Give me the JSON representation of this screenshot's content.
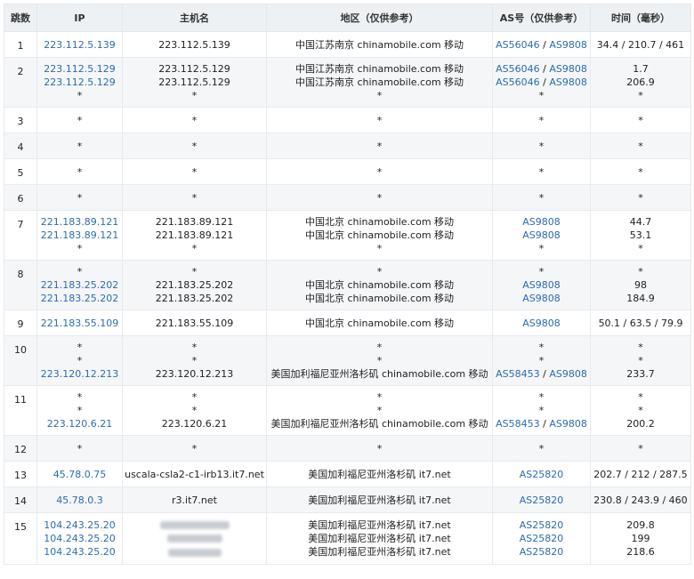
{
  "headers": {
    "hop": "跳数",
    "ip": "IP",
    "host": "主机名",
    "region": "地区（仅供参考）",
    "as": "AS号（仅供参考）",
    "time": "时间（毫秒）"
  },
  "rows": [
    {
      "hop": "1",
      "ip": [
        "223.112.5.139"
      ],
      "host": [
        "223.112.5.139"
      ],
      "region": [
        "中国江苏南京 chinamobile.com 移动"
      ],
      "as": [
        [
          "AS56046",
          "AS9808"
        ]
      ],
      "time": [
        "34.4 / 210.7 / 461"
      ]
    },
    {
      "hop": "2",
      "ip": [
        "223.112.5.129",
        "223.112.5.129",
        "*"
      ],
      "host": [
        "223.112.5.129",
        "223.112.5.129",
        "*"
      ],
      "region": [
        "中国江苏南京 chinamobile.com 移动",
        "中国江苏南京 chinamobile.com 移动",
        "*"
      ],
      "as": [
        [
          "AS56046",
          "AS9808"
        ],
        [
          "AS56046",
          "AS9808"
        ],
        "*"
      ],
      "time": [
        "1.7",
        "206.9",
        "*"
      ]
    },
    {
      "hop": "3",
      "ip": [
        "*"
      ],
      "host": [
        "*"
      ],
      "region": [
        "*"
      ],
      "as": [
        "*"
      ],
      "time": [
        "*"
      ]
    },
    {
      "hop": "4",
      "ip": [
        "*"
      ],
      "host": [
        "*"
      ],
      "region": [
        "*"
      ],
      "as": [
        "*"
      ],
      "time": [
        "*"
      ]
    },
    {
      "hop": "5",
      "ip": [
        "*"
      ],
      "host": [
        "*"
      ],
      "region": [
        "*"
      ],
      "as": [
        "*"
      ],
      "time": [
        "*"
      ]
    },
    {
      "hop": "6",
      "ip": [
        "*"
      ],
      "host": [
        "*"
      ],
      "region": [
        "*"
      ],
      "as": [
        "*"
      ],
      "time": [
        "*"
      ]
    },
    {
      "hop": "7",
      "ip": [
        "221.183.89.121",
        "221.183.89.121",
        "*"
      ],
      "host": [
        "221.183.89.121",
        "221.183.89.121",
        "*"
      ],
      "region": [
        "中国北京 chinamobile.com 移动",
        "中国北京 chinamobile.com 移动",
        "*"
      ],
      "as": [
        [
          "AS9808"
        ],
        [
          "AS9808"
        ],
        "*"
      ],
      "time": [
        "44.7",
        "53.1",
        "*"
      ]
    },
    {
      "hop": "8",
      "ip": [
        "*",
        "221.183.25.202",
        "221.183.25.202"
      ],
      "host": [
        "*",
        "221.183.25.202",
        "221.183.25.202"
      ],
      "region": [
        "*",
        "中国北京 chinamobile.com 移动",
        "中国北京 chinamobile.com 移动"
      ],
      "as": [
        "*",
        [
          "AS9808"
        ],
        [
          "AS9808"
        ]
      ],
      "time": [
        "*",
        "98",
        "184.9"
      ]
    },
    {
      "hop": "9",
      "ip": [
        "221.183.55.109"
      ],
      "host": [
        "221.183.55.109"
      ],
      "region": [
        "中国北京 chinamobile.com 移动"
      ],
      "as": [
        [
          "AS9808"
        ]
      ],
      "time": [
        "50.1 / 63.5 / 79.9"
      ]
    },
    {
      "hop": "10",
      "ip": [
        "*",
        "*",
        "223.120.12.213"
      ],
      "host": [
        "*",
        "*",
        "223.120.12.213"
      ],
      "region": [
        "*",
        "*",
        "美国加利福尼亚州洛杉矶 chinamobile.com 移动"
      ],
      "as": [
        "*",
        "*",
        [
          "AS58453",
          "AS9808"
        ]
      ],
      "time": [
        "*",
        "*",
        "233.7"
      ]
    },
    {
      "hop": "11",
      "ip": [
        "*",
        "*",
        "223.120.6.21"
      ],
      "host": [
        "*",
        "*",
        "223.120.6.21"
      ],
      "region": [
        "*",
        "*",
        "美国加利福尼亚州洛杉矶 chinamobile.com 移动"
      ],
      "as": [
        "*",
        "*",
        [
          "AS58453",
          "AS9808"
        ]
      ],
      "time": [
        "*",
        "*",
        "200.2"
      ]
    },
    {
      "hop": "12",
      "ip": [
        "*"
      ],
      "host": [
        "*"
      ],
      "region": [
        "*"
      ],
      "as": [
        "*"
      ],
      "time": [
        "*"
      ]
    },
    {
      "hop": "13",
      "ip": [
        "45.78.0.75"
      ],
      "host": [
        "uscala-csla2-c1-irb13.it7.net"
      ],
      "region": [
        "美国加利福尼亚州洛杉矶 it7.net"
      ],
      "as": [
        [
          "AS25820"
        ]
      ],
      "time": [
        "202.7 / 212 / 287.5"
      ]
    },
    {
      "hop": "14",
      "ip": [
        "45.78.0.3"
      ],
      "host": [
        "r3.it7.net"
      ],
      "region": [
        "美国加利福尼亚州洛杉矶 it7.net"
      ],
      "as": [
        [
          "AS25820"
        ]
      ],
      "time": [
        "230.8 / 243.9 / 460"
      ]
    },
    {
      "hop": "15",
      "ip": [
        "104.243.25.20",
        "104.243.25.20",
        "104.243.25.20"
      ],
      "host": [
        "__blur__",
        "__blur__",
        "__blur__"
      ],
      "region": [
        "美国加利福尼亚州洛杉矶 it7.net",
        "美国加利福尼亚州洛杉矶 it7.net",
        "美国加利福尼亚州洛杉矶 it7.net"
      ],
      "as": [
        [
          "AS25820"
        ],
        [
          "AS25820"
        ],
        [
          "AS25820"
        ]
      ],
      "time": [
        "209.8",
        "199",
        "218.6"
      ]
    }
  ]
}
